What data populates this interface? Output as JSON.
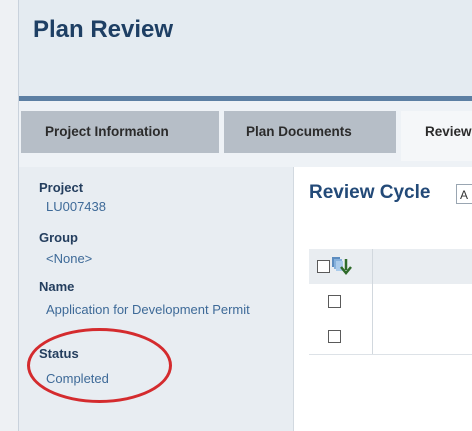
{
  "header": {
    "title": "Plan Review"
  },
  "tabs": [
    {
      "label": "Project Information"
    },
    {
      "label": "Plan Documents"
    },
    {
      "label": "Review"
    }
  ],
  "sidebar": {
    "fields": [
      {
        "label": "Project",
        "value": "LU007438"
      },
      {
        "label": "Group",
        "value": "<None>"
      },
      {
        "label": "Name",
        "value": "Application for Development Permit"
      },
      {
        "label": "Status",
        "value": "Completed"
      }
    ]
  },
  "main": {
    "section_title": "Review Cycle",
    "cycle_select_value": "A"
  },
  "colors": {
    "accent": "#234a78",
    "highlight": "#d42b2e",
    "tab_inactive": "#b6bec7"
  },
  "icons": [
    "download-icon"
  ]
}
